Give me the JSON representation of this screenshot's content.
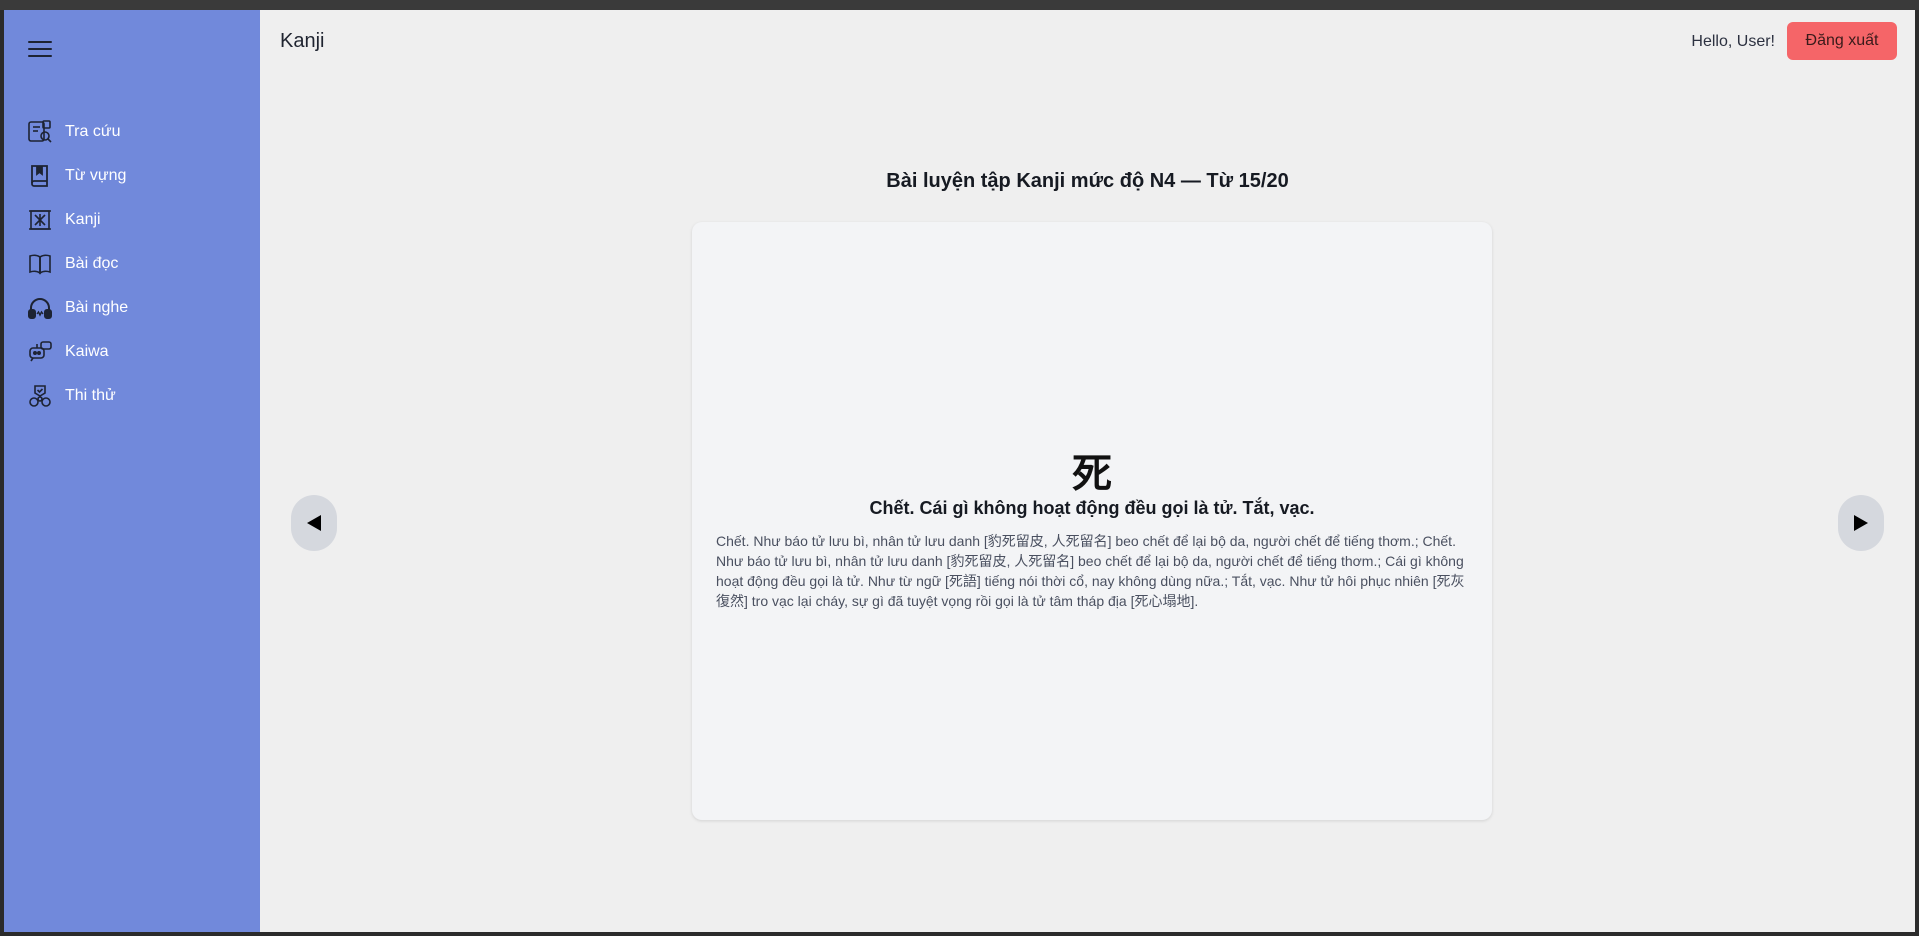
{
  "header": {
    "page_title": "Kanji",
    "greeting": "Hello, User!",
    "logout_label": "Đăng xuất"
  },
  "sidebar": {
    "items": [
      {
        "label": "Tra cứu",
        "icon": "dictionary-search-icon"
      },
      {
        "label": "Từ vựng",
        "icon": "bookmark-book-icon"
      },
      {
        "label": "Kanji",
        "icon": "kanji-frame-icon"
      },
      {
        "label": "Bài đọc",
        "icon": "open-book-icon"
      },
      {
        "label": "Bài nghe",
        "icon": "headphones-icon"
      },
      {
        "label": "Kaiwa",
        "icon": "robot-chat-icon"
      },
      {
        "label": "Thi thử",
        "icon": "exam-badge-icon"
      }
    ]
  },
  "lesson": {
    "title": "Bài luyện tập Kanji mức độ N4 — Từ 15/20",
    "kanji": "死",
    "meaning": "Chết. Cái gì không hoạt động đều gọi là tử. Tắt, vạc.",
    "description": "Chết. Như báo tử lưu bì, nhân tử lưu danh [豹死留皮, 人死留名] beo chết để lại bộ da, người chết để tiếng thơm.; Chết. Như báo tử lưu bì, nhân tử lưu danh [豹死留皮, 人死留名] beo chết để lại bộ da, người chết để tiếng thơm.; Cái gì không hoạt động đều gọi là tử. Như từ ngữ [死語] tiếng nói thời cổ, nay không dùng nữa.; Tắt, vạc. Như tử hôi phục nhiên [死灰復然] tro vạc lại cháy, sự gì đã tuyệt vọng rồi gọi là tử tâm tháp địa [死心塌地]."
  },
  "colors": {
    "sidebar_bg": "#7189db",
    "main_bg": "#efefef",
    "logout_bg": "#f56568",
    "card_bg": "#f3f4f6",
    "arrow_bg": "#d5d8de"
  }
}
